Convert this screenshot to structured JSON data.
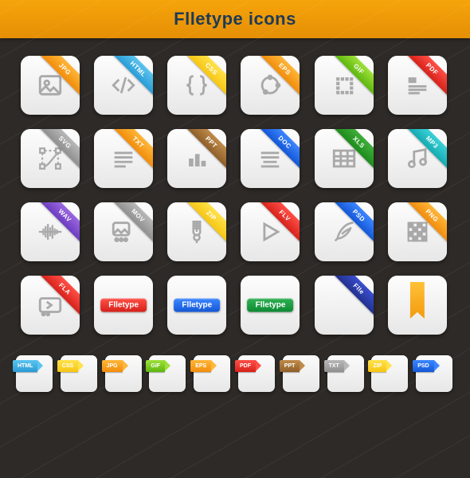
{
  "title": "Flletype icons",
  "colors": {
    "orange": "linear-gradient(#ffb638,#f18c0c)",
    "sky": "linear-gradient(#5bc4ef,#2a9bd6)",
    "yellow": "linear-gradient(#ffe24a,#f6c513)",
    "green": "linear-gradient(#9fe03a,#5eb60f)",
    "greenDk": "linear-gradient(#3fae3a,#1d8b1b)",
    "red": "linear-gradient(#ff4f46,#d6211a)",
    "purple": "linear-gradient(#9a68e0,#6c3cc1)",
    "grey": "linear-gradient(#b8b8b8,#8f8f8f)",
    "blue": "linear-gradient(#3d86ff,#1357d6)",
    "brown": "linear-gradient(#c08a4a,#8d5f29)",
    "cyan": "linear-gradient(#3bd2d8,#14aab1)",
    "navy": "linear-gradient(#3a4ecf,#22318f)",
    "greenMid": "linear-gradient(#2fb153,#0d8a33)"
  },
  "icons": [
    {
      "label": "JPG",
      "color": "orange",
      "glyph": "image"
    },
    {
      "label": "HTML",
      "color": "sky",
      "glyph": "code"
    },
    {
      "label": "CSS",
      "color": "yellow",
      "glyph": "braces"
    },
    {
      "label": "EPS",
      "color": "orange",
      "glyph": "vector"
    },
    {
      "label": "GIF",
      "color": "green",
      "glyph": "pixel"
    },
    {
      "label": "PDF",
      "color": "red",
      "glyph": "doc"
    },
    {
      "label": "SVG",
      "color": "grey",
      "glyph": "bezier"
    },
    {
      "label": "TXT",
      "color": "orange",
      "glyph": "text"
    },
    {
      "label": "PPT",
      "color": "brown",
      "glyph": "bars"
    },
    {
      "label": "DOC",
      "color": "blue",
      "glyph": "para"
    },
    {
      "label": "XLS",
      "color": "greenDk",
      "glyph": "table"
    },
    {
      "label": "MP3",
      "color": "cyan",
      "glyph": "note"
    },
    {
      "label": "WAV",
      "color": "purple",
      "glyph": "wave"
    },
    {
      "label": "MOV",
      "color": "grey",
      "glyph": "video"
    },
    {
      "label": "ZIP",
      "color": "yellow",
      "glyph": "zip"
    },
    {
      "label": "FLV",
      "color": "red",
      "glyph": "play"
    },
    {
      "label": "PSD",
      "color": "blue",
      "glyph": "feather"
    },
    {
      "label": "PNG",
      "color": "orange",
      "glyph": "checker"
    },
    {
      "label": "FLA",
      "color": "red",
      "glyph": "flash"
    },
    {
      "center": "Flletype",
      "centerColor": "red"
    },
    {
      "center": "Flletype",
      "centerColor": "blue"
    },
    {
      "center": "Flletype",
      "centerColor": "greenMid"
    },
    {
      "label": "Flle",
      "color": "navy",
      "glyph": ""
    },
    {
      "bookmark": true
    }
  ],
  "small": [
    {
      "label": "HTML",
      "color": "sky"
    },
    {
      "label": "CSS",
      "color": "yellow"
    },
    {
      "label": "JPG",
      "color": "orange"
    },
    {
      "label": "GIF",
      "color": "green"
    },
    {
      "label": "EPS",
      "color": "orange"
    },
    {
      "label": "PDF",
      "color": "red"
    },
    {
      "label": "PPT",
      "color": "brown"
    },
    {
      "label": "TXT",
      "color": "grey"
    },
    {
      "label": "ZIP",
      "color": "yellow"
    },
    {
      "label": "PSD",
      "color": "blue"
    }
  ]
}
